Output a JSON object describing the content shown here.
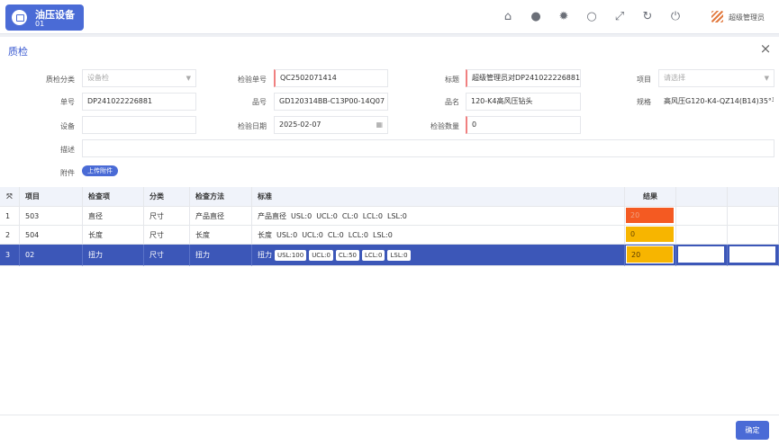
{
  "app": {
    "title": "油压设备",
    "subtitle": "01"
  },
  "header": {
    "user": "超级管理员",
    "icons": [
      "home-icon",
      "user-icon",
      "gear-icon",
      "settings-circle-icon",
      "fullscreen-icon",
      "refresh-icon",
      "power-icon"
    ]
  },
  "dialog": {
    "title": "质检",
    "close": "×",
    "labels": {
      "category": "质检分类",
      "inspection_no": "检验单号",
      "title": "标题",
      "item": "项目",
      "order_no": "单号",
      "part_no": "品号",
      "part_name": "品名",
      "spec": "规格",
      "device": "设备",
      "inspection_date": "检验日期",
      "quantity": "检验数量",
      "description": "描述",
      "attachment": "附件"
    },
    "values": {
      "category": "设备检",
      "inspection_no": "QC2502071414",
      "title": "超级管理员对DP241022226881的",
      "item_placeholder": "请选择",
      "order_no": "DP241022226881",
      "part_no": "GD120314BB-C13P00-14Q07",
      "part_name": "120-K4高风压钻头",
      "spec": "高风压G120-K4-QZ14(B14)35°平",
      "device": "",
      "inspection_date": "2025-02-07",
      "quantity": "0",
      "description": ""
    },
    "upload_label": "上传附件",
    "ok_label": "确定"
  },
  "table": {
    "headers": {
      "item": "项目",
      "check_item": "检查项",
      "category": "分类",
      "method": "检查方法",
      "standard": "标准",
      "result": "结果"
    },
    "rows": [
      {
        "no": "1",
        "item": "503",
        "check_item": "直径",
        "category": "尺寸",
        "method": "产品直径",
        "standard": [
          [
            "产品直径",
            ""
          ],
          [
            "USL:0",
            ""
          ],
          [
            "UCL:0",
            ""
          ],
          [
            "CL:0",
            ""
          ],
          [
            "LCL:0",
            ""
          ],
          [
            "LSL:0",
            ""
          ]
        ],
        "result": "20",
        "result_color": "#f45a22"
      },
      {
        "no": "2",
        "item": "504",
        "check_item": "长度",
        "category": "尺寸",
        "method": "长度",
        "standard": [
          [
            "长度",
            ""
          ],
          [
            "USL:0",
            ""
          ],
          [
            "UCL:0",
            ""
          ],
          [
            "CL:0",
            ""
          ],
          [
            "LCL:0",
            ""
          ],
          [
            "LSL:0",
            ""
          ]
        ],
        "result": "0",
        "result_color": "#f7b500"
      },
      {
        "no": "3",
        "item": "02",
        "check_item": "扭力",
        "category": "尺寸",
        "method": "扭力",
        "standard_label": "扭力",
        "standard_chips": [
          "USL:100",
          "UCL:0",
          "CL:50",
          "LCL:0",
          "LSL:0"
        ],
        "result": "20",
        "result_color": "#f7b500"
      }
    ]
  }
}
